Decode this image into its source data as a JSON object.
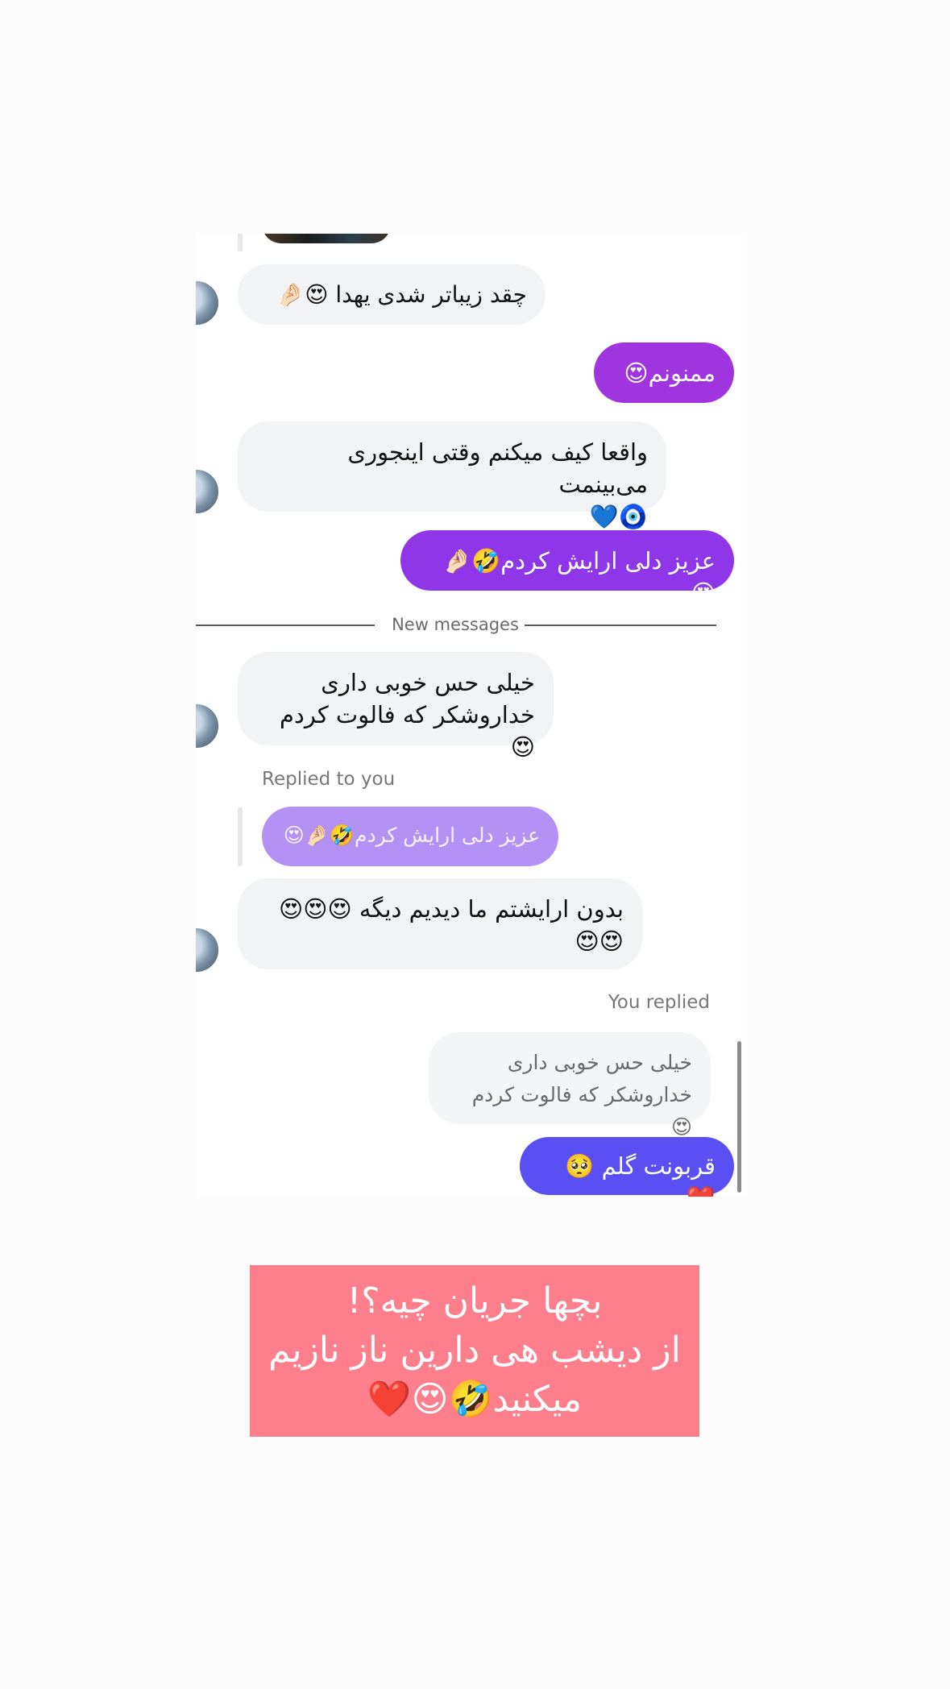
{
  "messages": [
    {
      "direction": "in",
      "text": "چقد زیباتر شدی یهدا 😍🤌🏻"
    },
    {
      "direction": "out",
      "text": "ممنونم😍"
    },
    {
      "direction": "in",
      "text": "واقعا کیف میکنم وقتی اینجوری می‌بینمت\n🧿💙"
    },
    {
      "direction": "out",
      "text": "عزیز دلی ارایش کردم🤣🤌🏻😍"
    },
    {
      "direction": "in",
      "text": "خیلی حس خوبی داری\nخداروشکر که فالوت کردم 😍"
    },
    {
      "direction": "in",
      "text": "بدون ارایشتم ما دیدیم دیگه 😍😍😍\n😍😍"
    },
    {
      "direction": "out",
      "text": "قربونت گلم 🥺❤️"
    }
  ],
  "divider": {
    "label": "New messages"
  },
  "reply_in": {
    "label": "Replied to you",
    "quoted_text": "عزیز دلی ارایش کردم🤣🤌🏻😍"
  },
  "reply_out": {
    "label": "You replied",
    "quoted_text": "خیلی حس خوبی داری\nخداروشکر که فالوت کردم 😍"
  },
  "caption": {
    "text": "بچها جریان چیه؟!\nاز دیشب هی دارین ناز نازیم\nمیکنید🤣😍❤️"
  },
  "colors": {
    "incoming_bubble": "#f2f3f5",
    "outgoing_purple": "#9b34e0",
    "outgoing_violet": "#8a39ea",
    "outgoing_blue": "#5a4ff2",
    "quoted_purple": "#b491f5",
    "caption_background": "#fc7f8b"
  }
}
